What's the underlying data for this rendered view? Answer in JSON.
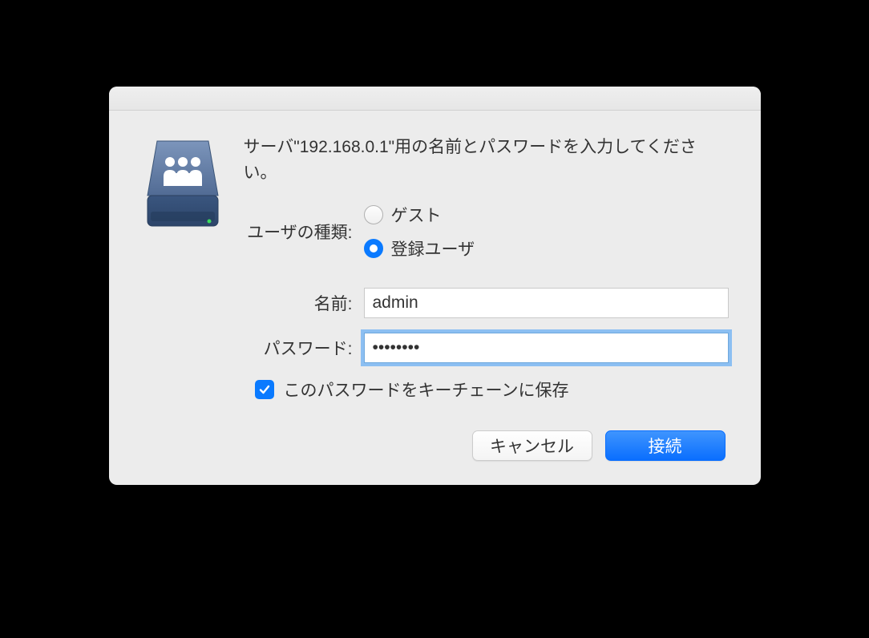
{
  "dialog": {
    "prompt": "サーバ\"192.168.0.1\"用の名前とパスワードを入力してください。",
    "user_type_label": "ユーザの種類:",
    "radios": {
      "guest": "ゲスト",
      "registered": "登録ユーザ"
    },
    "name_label": "名前:",
    "name_value": "admin",
    "password_label": "パスワード:",
    "password_value": "••••••••",
    "remember_label": "このパスワードをキーチェーンに保存",
    "cancel": "キャンセル",
    "connect": "接続"
  }
}
